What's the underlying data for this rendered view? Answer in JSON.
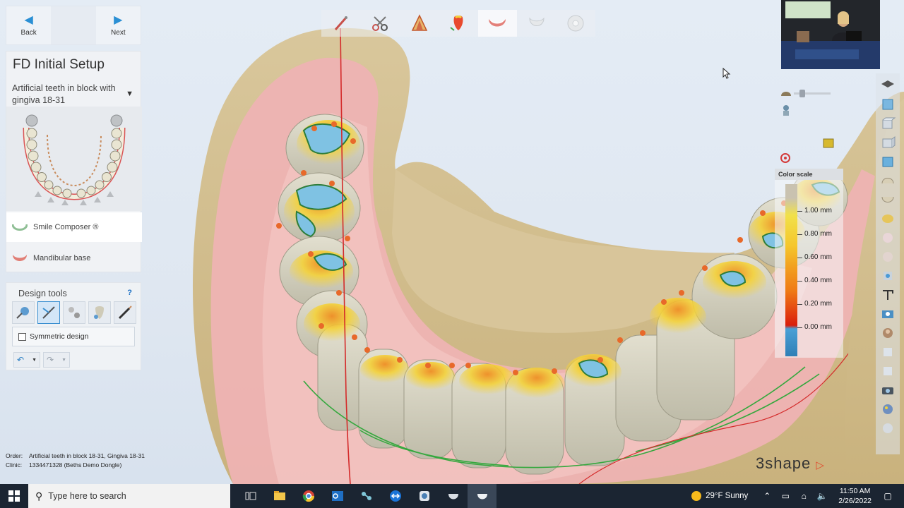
{
  "nav": {
    "back_label": "Back",
    "next_label": "Next"
  },
  "panel": {
    "title": "FD Initial Setup",
    "subtitle": "Artificial teeth in block with gingiva 18-31",
    "items": [
      {
        "label": "Smile Composer ®"
      },
      {
        "label": "Mandibular base"
      }
    ]
  },
  "design_tools": {
    "title": "Design tools",
    "help": "?",
    "symmetric_label": "Symmetric design",
    "symmetric_checked": false
  },
  "order_info": {
    "order_key": "Order:",
    "order_value": "Artificial teeth in block 18-31, Gingiva 18-31",
    "clinic_key": "Clinic:",
    "clinic_value": "1334471328 (Beths Demo Dongle)"
  },
  "color_scale": {
    "title": "Color scale",
    "labels": [
      "1.00 mm",
      "0.80 mm",
      "0.60 mm",
      "0.40 mm",
      "0.20 mm",
      "0.00 mm"
    ]
  },
  "brand": "3shape",
  "taskbar": {
    "search_placeholder": "Type here to search",
    "weather": "29°F  Sunny",
    "time": "11:50 AM",
    "date": "2/26/2022"
  },
  "colors": {
    "accent": "#2a8fd4",
    "gingiva": "#eeb3b3",
    "base": "#d6c397",
    "tooth": "#d9d5c3",
    "taskbar": "#1b2532"
  }
}
